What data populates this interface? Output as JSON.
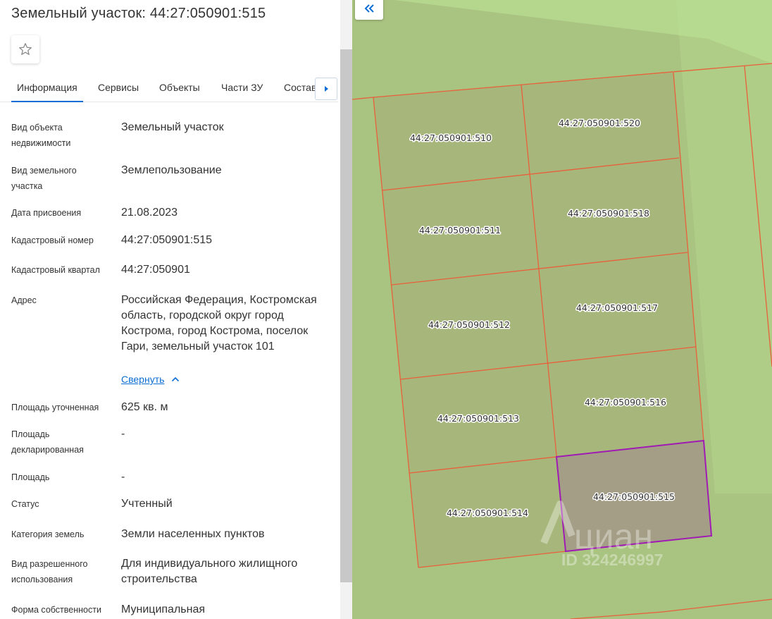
{
  "header": {
    "title": "Земельный участок: 44:27:050901:515",
    "favorite_icon": "star-outline-icon"
  },
  "tabs": [
    {
      "label": "Информация",
      "active": true
    },
    {
      "label": "Сервисы"
    },
    {
      "label": "Объекты"
    },
    {
      "label": "Части ЗУ"
    },
    {
      "label": "Состав"
    }
  ],
  "info": {
    "object_type": {
      "label": "Вид объекта недвижимости",
      "value": "Земельный участок"
    },
    "land_type": {
      "label": "Вид земельного участка",
      "value": "Землепользование"
    },
    "date": {
      "label": "Дата присвоения",
      "value": "21.08.2023"
    },
    "cadastral_number": {
      "label": "Кадастровый номер",
      "value": "44:27:050901:515"
    },
    "cadastral_block": {
      "label": "Кадастровый квартал",
      "value": "44:27:050901"
    },
    "address": {
      "label": "Адрес",
      "value": "Российская Федерация, Костромская область, городской округ город Кострома, город Кострома, поселок Гари, земельный участок 101",
      "collapse_link": "Свернуть"
    },
    "area_specified": {
      "label": "Площадь уточненная",
      "value": "625 кв. м"
    },
    "area_declared": {
      "label": "Площадь декларированная",
      "value": "-"
    },
    "area": {
      "label": "Площадь",
      "value": "-"
    },
    "status": {
      "label": "Статус",
      "value": "Учтенный"
    },
    "land_category": {
      "label": "Категория земель",
      "value": "Земли населенных пунктов"
    },
    "permitted_use": {
      "label": "Вид разрешенного использования",
      "value": "Для индивидуального жилищного строительства"
    },
    "ownership": {
      "label": "Форма собственности",
      "value": "Муниципальная"
    }
  },
  "map": {
    "parcels": {
      "p510": "44:27:050901:510",
      "p520": "44:27:050901:520",
      "p511": "44:27:050901:511",
      "p518": "44:27:050901:518",
      "p512": "44:27:050901:512",
      "p517": "44:27:050901:517",
      "p513": "44:27:050901:513",
      "p516": "44:27:050901:516",
      "p514": "44:27:050901:514",
      "p515": "44:27:050901:515"
    },
    "selected_parcel": "44:27:050901:515",
    "watermark_brand": "циан",
    "watermark_id": "ID 324246997",
    "colors": {
      "map_green": "#a9c381",
      "boundary": "#e8603a",
      "selected": "#a01bb4",
      "selected_fill": "#a59e86"
    }
  }
}
